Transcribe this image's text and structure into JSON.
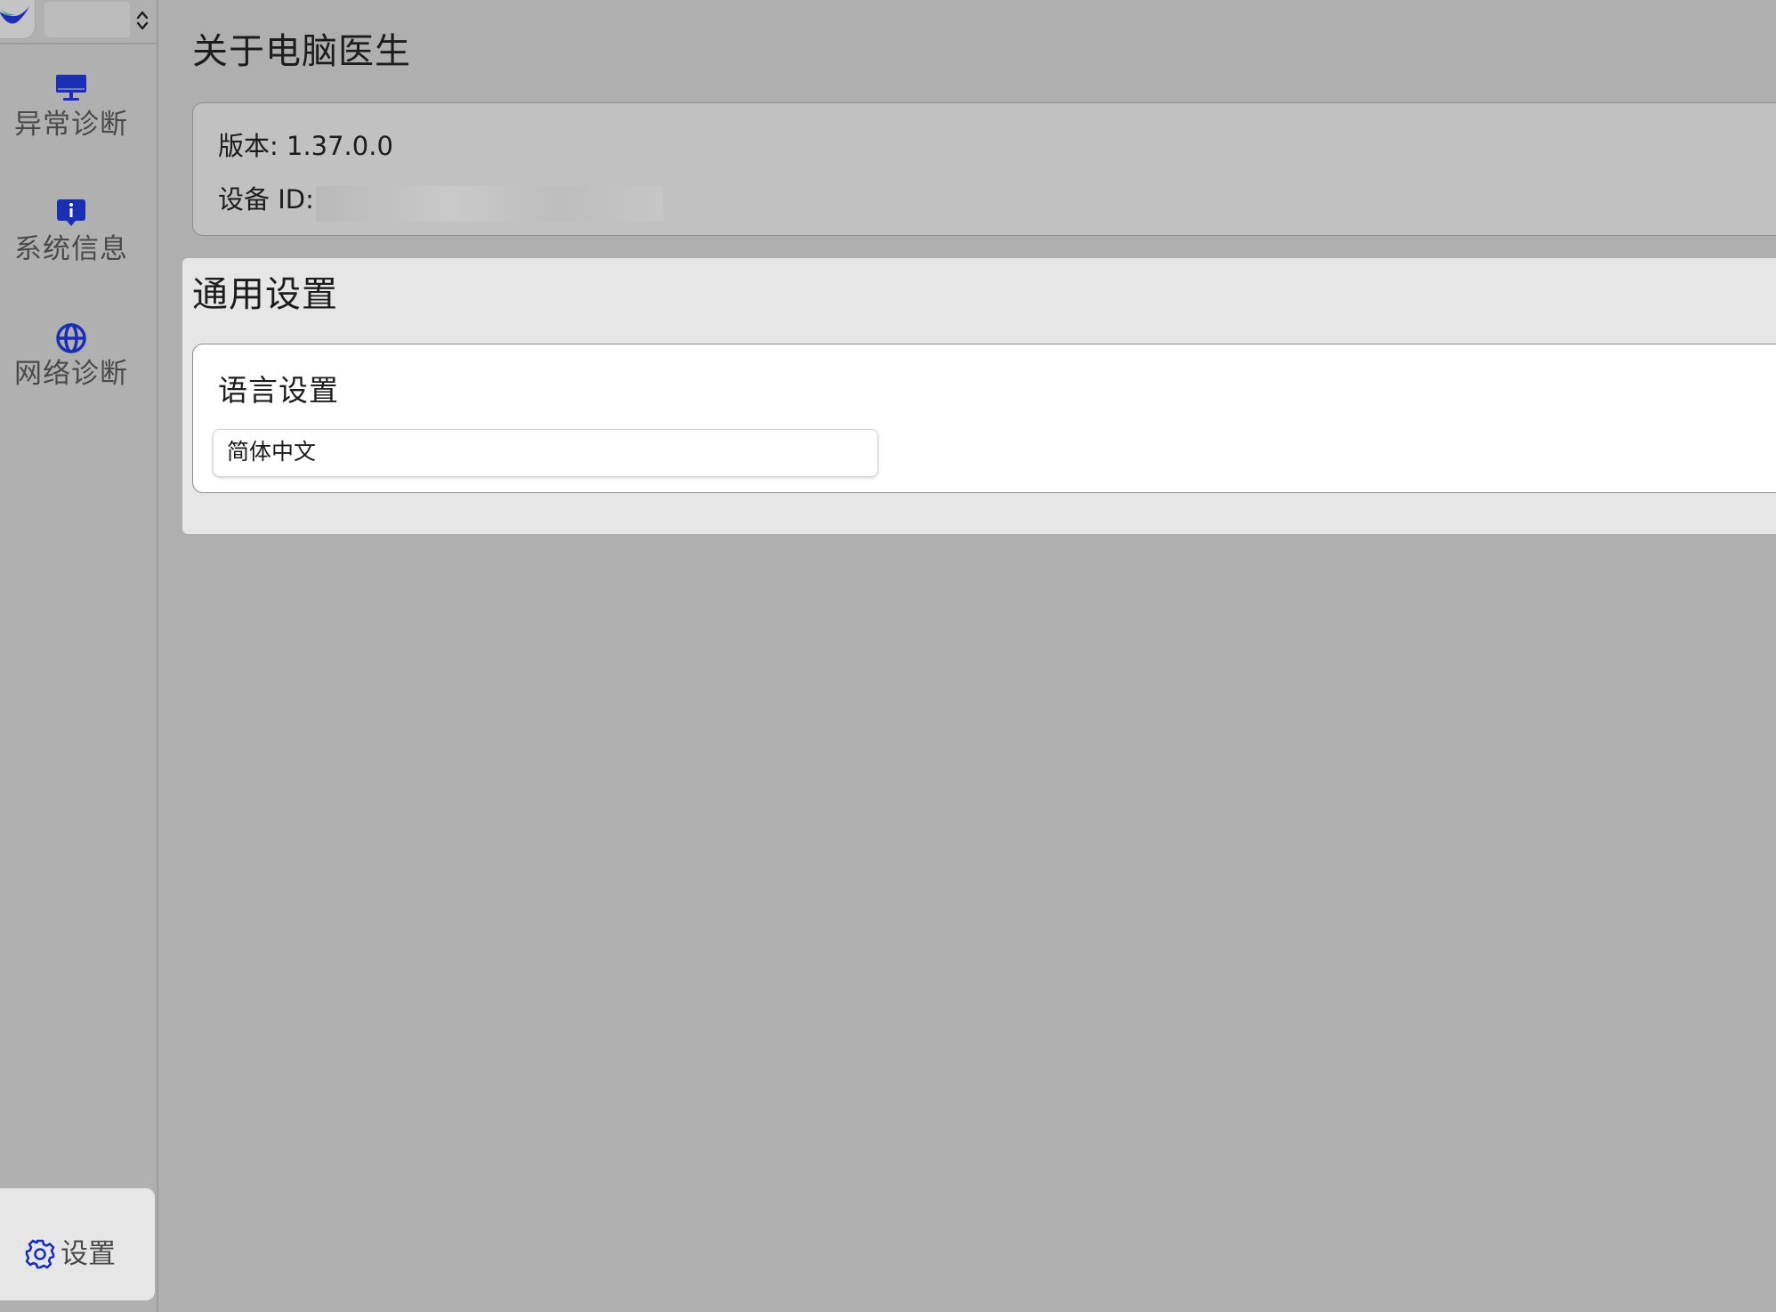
{
  "sidebar": {
    "app_switcher": {
      "logo_icon": "app-logo-icon",
      "chevron_icon": "up-down-chevron-icon"
    },
    "items": [
      {
        "label": "异常诊断",
        "icon": "monitor-icon"
      },
      {
        "label": "系统信息",
        "icon": "info-icon"
      },
      {
        "label": "网络诊断",
        "icon": "globe-icon"
      }
    ],
    "settings": {
      "label": "设置",
      "icon": "gear-icon"
    },
    "icon_color": "#1b2fb5"
  },
  "about": {
    "title": "关于电脑医生",
    "version_text": "版本: 1.37.0.0",
    "device_id_label": "设备 ID:"
  },
  "general": {
    "title": "通用设置",
    "language": {
      "title": "语言设置",
      "selected": "简体中文"
    }
  }
}
